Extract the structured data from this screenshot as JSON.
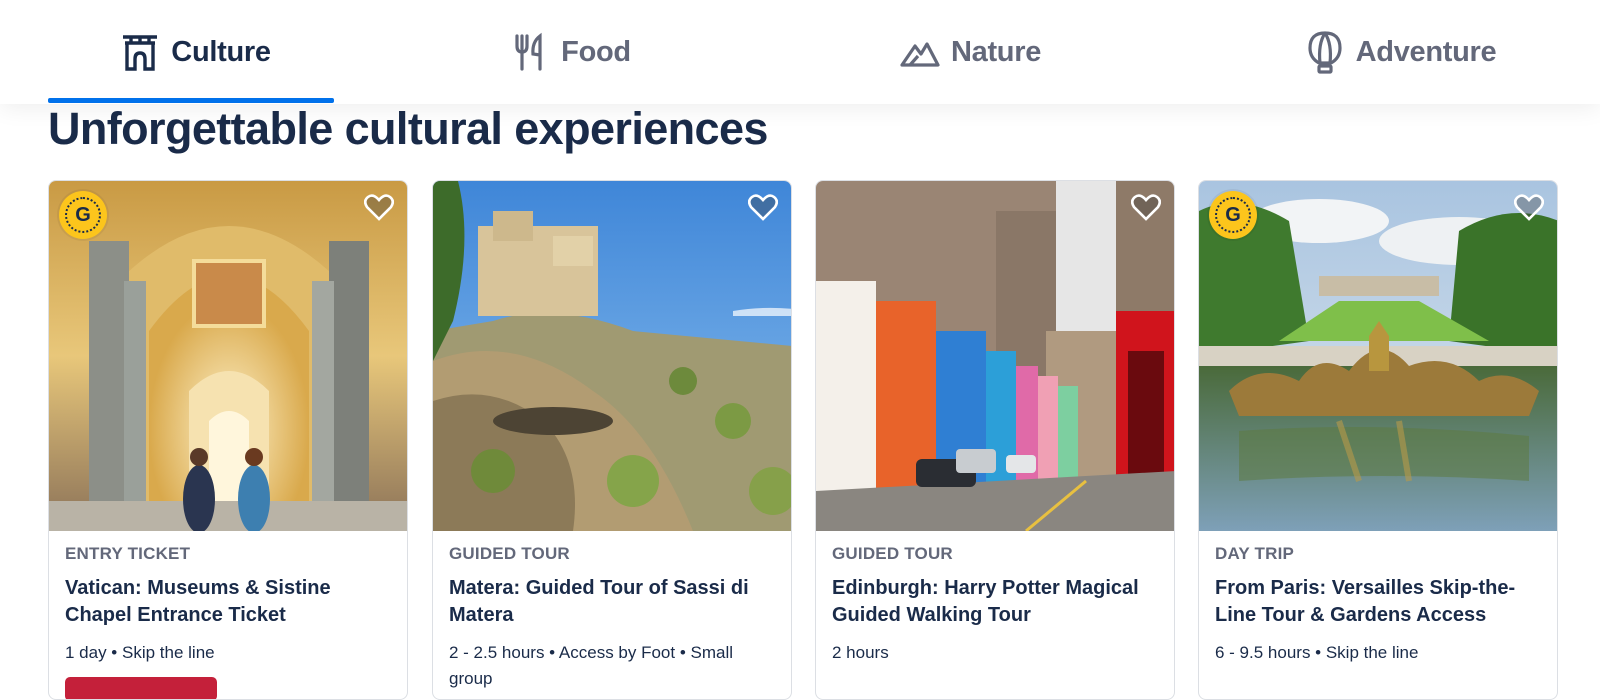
{
  "tabs": [
    {
      "label": "Culture",
      "icon": "culture-arch-icon",
      "active": true
    },
    {
      "label": "Food",
      "icon": "fork-knife-icon",
      "active": false
    },
    {
      "label": "Nature",
      "icon": "mountain-icon",
      "active": false
    },
    {
      "label": "Adventure",
      "icon": "hot-air-balloon-icon",
      "active": false
    }
  ],
  "section": {
    "heading": "Unforgettable cultural experiences"
  },
  "badge": {
    "letter": "G",
    "color": "#fcc51c"
  },
  "colors": {
    "accent": "#0071eb",
    "text": "#1a2b49",
    "muted": "#63687a",
    "deal": "#c4203a"
  },
  "cards": [
    {
      "category": "ENTRY TICKET",
      "title": "Vatican: Museums & Sistine Chapel Entrance Ticket",
      "details": "1 day • Skip the line",
      "has_badge": true,
      "image": "vatican-museum-corridor"
    },
    {
      "category": "GUIDED TOUR",
      "title": "Matera: Guided Tour of Sassi di Matera",
      "details": "2 - 2.5 hours • Access by Foot • Small group",
      "has_badge": false,
      "image": "matera-cliffs"
    },
    {
      "category": "GUIDED TOUR",
      "title": "Edinburgh: Harry Potter Magical Guided Walking Tour",
      "details": "2 hours",
      "has_badge": false,
      "image": "edinburgh-colorful-street"
    },
    {
      "category": "DAY TRIP",
      "title": "From Paris: Versailles Skip-the-Line Tour & Gardens Access",
      "details": "6 - 9.5 hours • Skip the line",
      "has_badge": true,
      "image": "versailles-fountain-gardens"
    }
  ]
}
